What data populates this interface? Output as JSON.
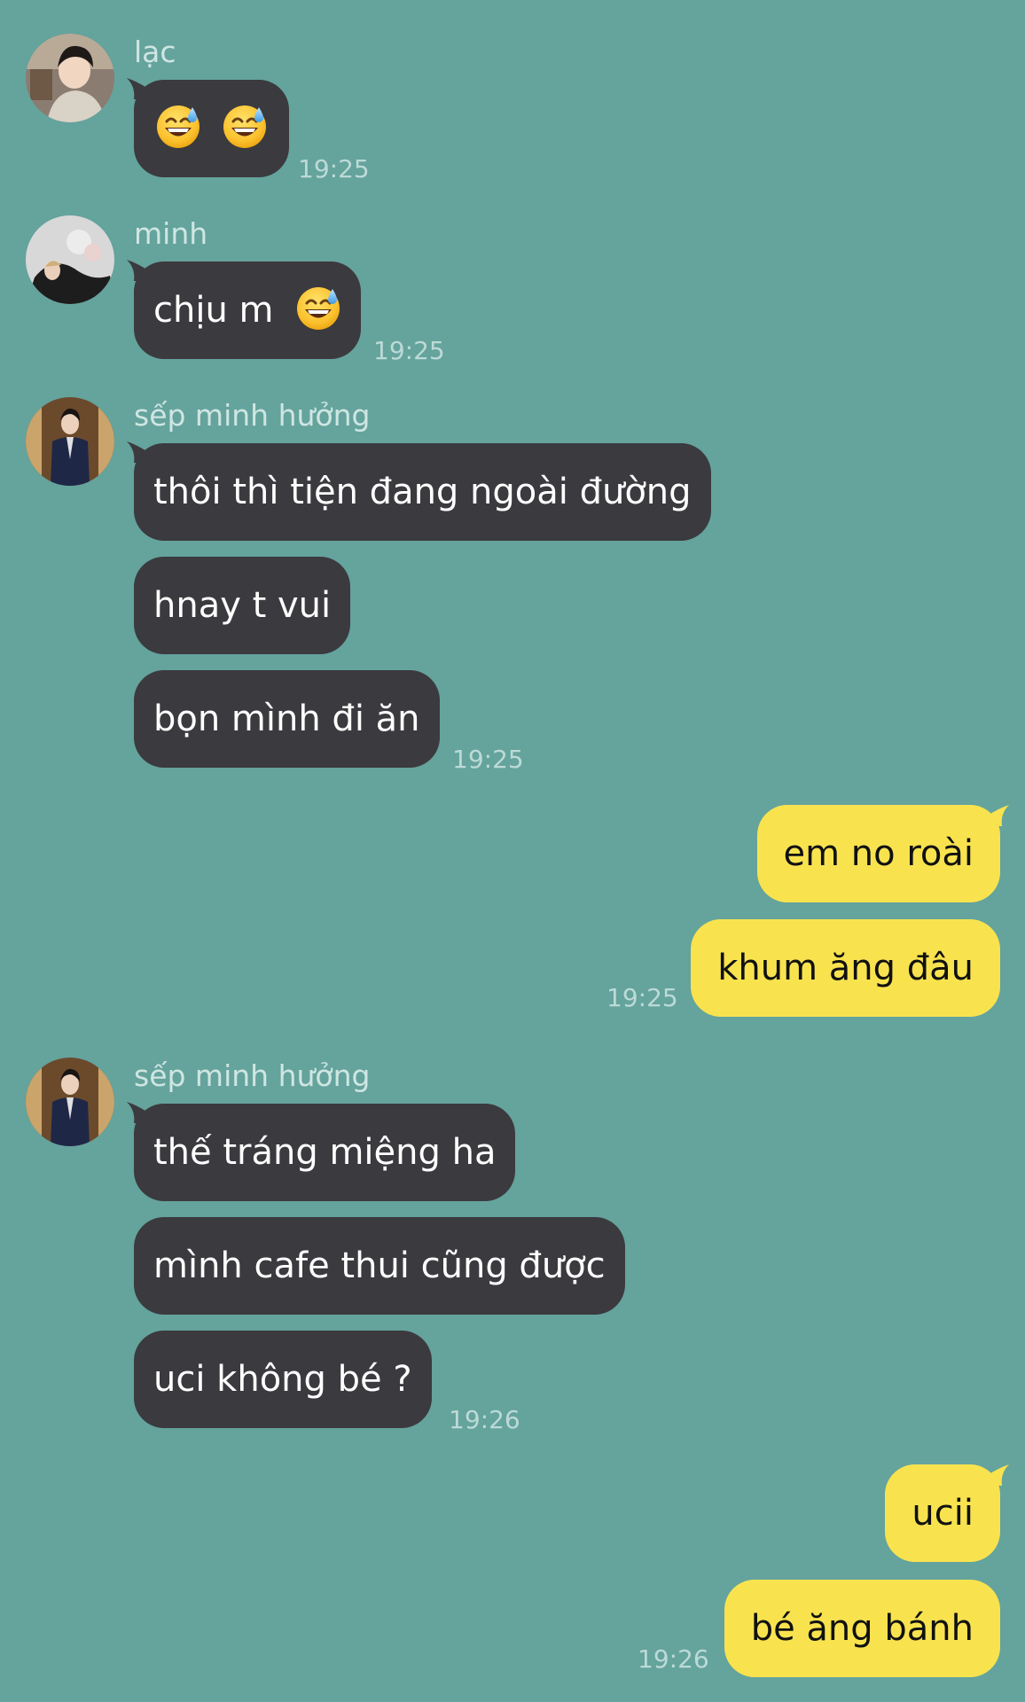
{
  "messages": [
    {
      "sender": "lạc",
      "text_before": "",
      "emoji_count": 2,
      "emoji": "grinning-sweat-emoji",
      "time": "19:25"
    },
    {
      "sender": "minh",
      "text_before": "chịu m",
      "emoji_count": 1,
      "emoji": "grinning-sweat-emoji",
      "time": "19:25"
    },
    {
      "sender": "sếp minh hưởng",
      "bubbles": [
        "thôi thì tiện đang ngoài đường",
        "hnay t vui",
        "bọn mình đi ăn"
      ],
      "time": "19:25"
    },
    {
      "sender": "",
      "outgoing": true,
      "bubbles": [
        "em no roài",
        "khum ăng đâu"
      ],
      "time": "19:25"
    },
    {
      "sender": "sếp minh hưởng",
      "bubbles": [
        "thế tráng miệng ha",
        "mình cafe thui cũng được",
        "uci không bé ?"
      ],
      "time": "19:26"
    },
    {
      "sender": "",
      "outgoing": true,
      "bubbles": [
        "ucii",
        "bé ăng bánh"
      ],
      "time": "19:26"
    }
  ],
  "colors": {
    "background": "#65a39d",
    "incoming_bubble": "#3b3a3e",
    "outgoing_bubble": "#f8e34f",
    "sender_name": "#cfe6e2",
    "timestamp": "#bcdad6"
  }
}
